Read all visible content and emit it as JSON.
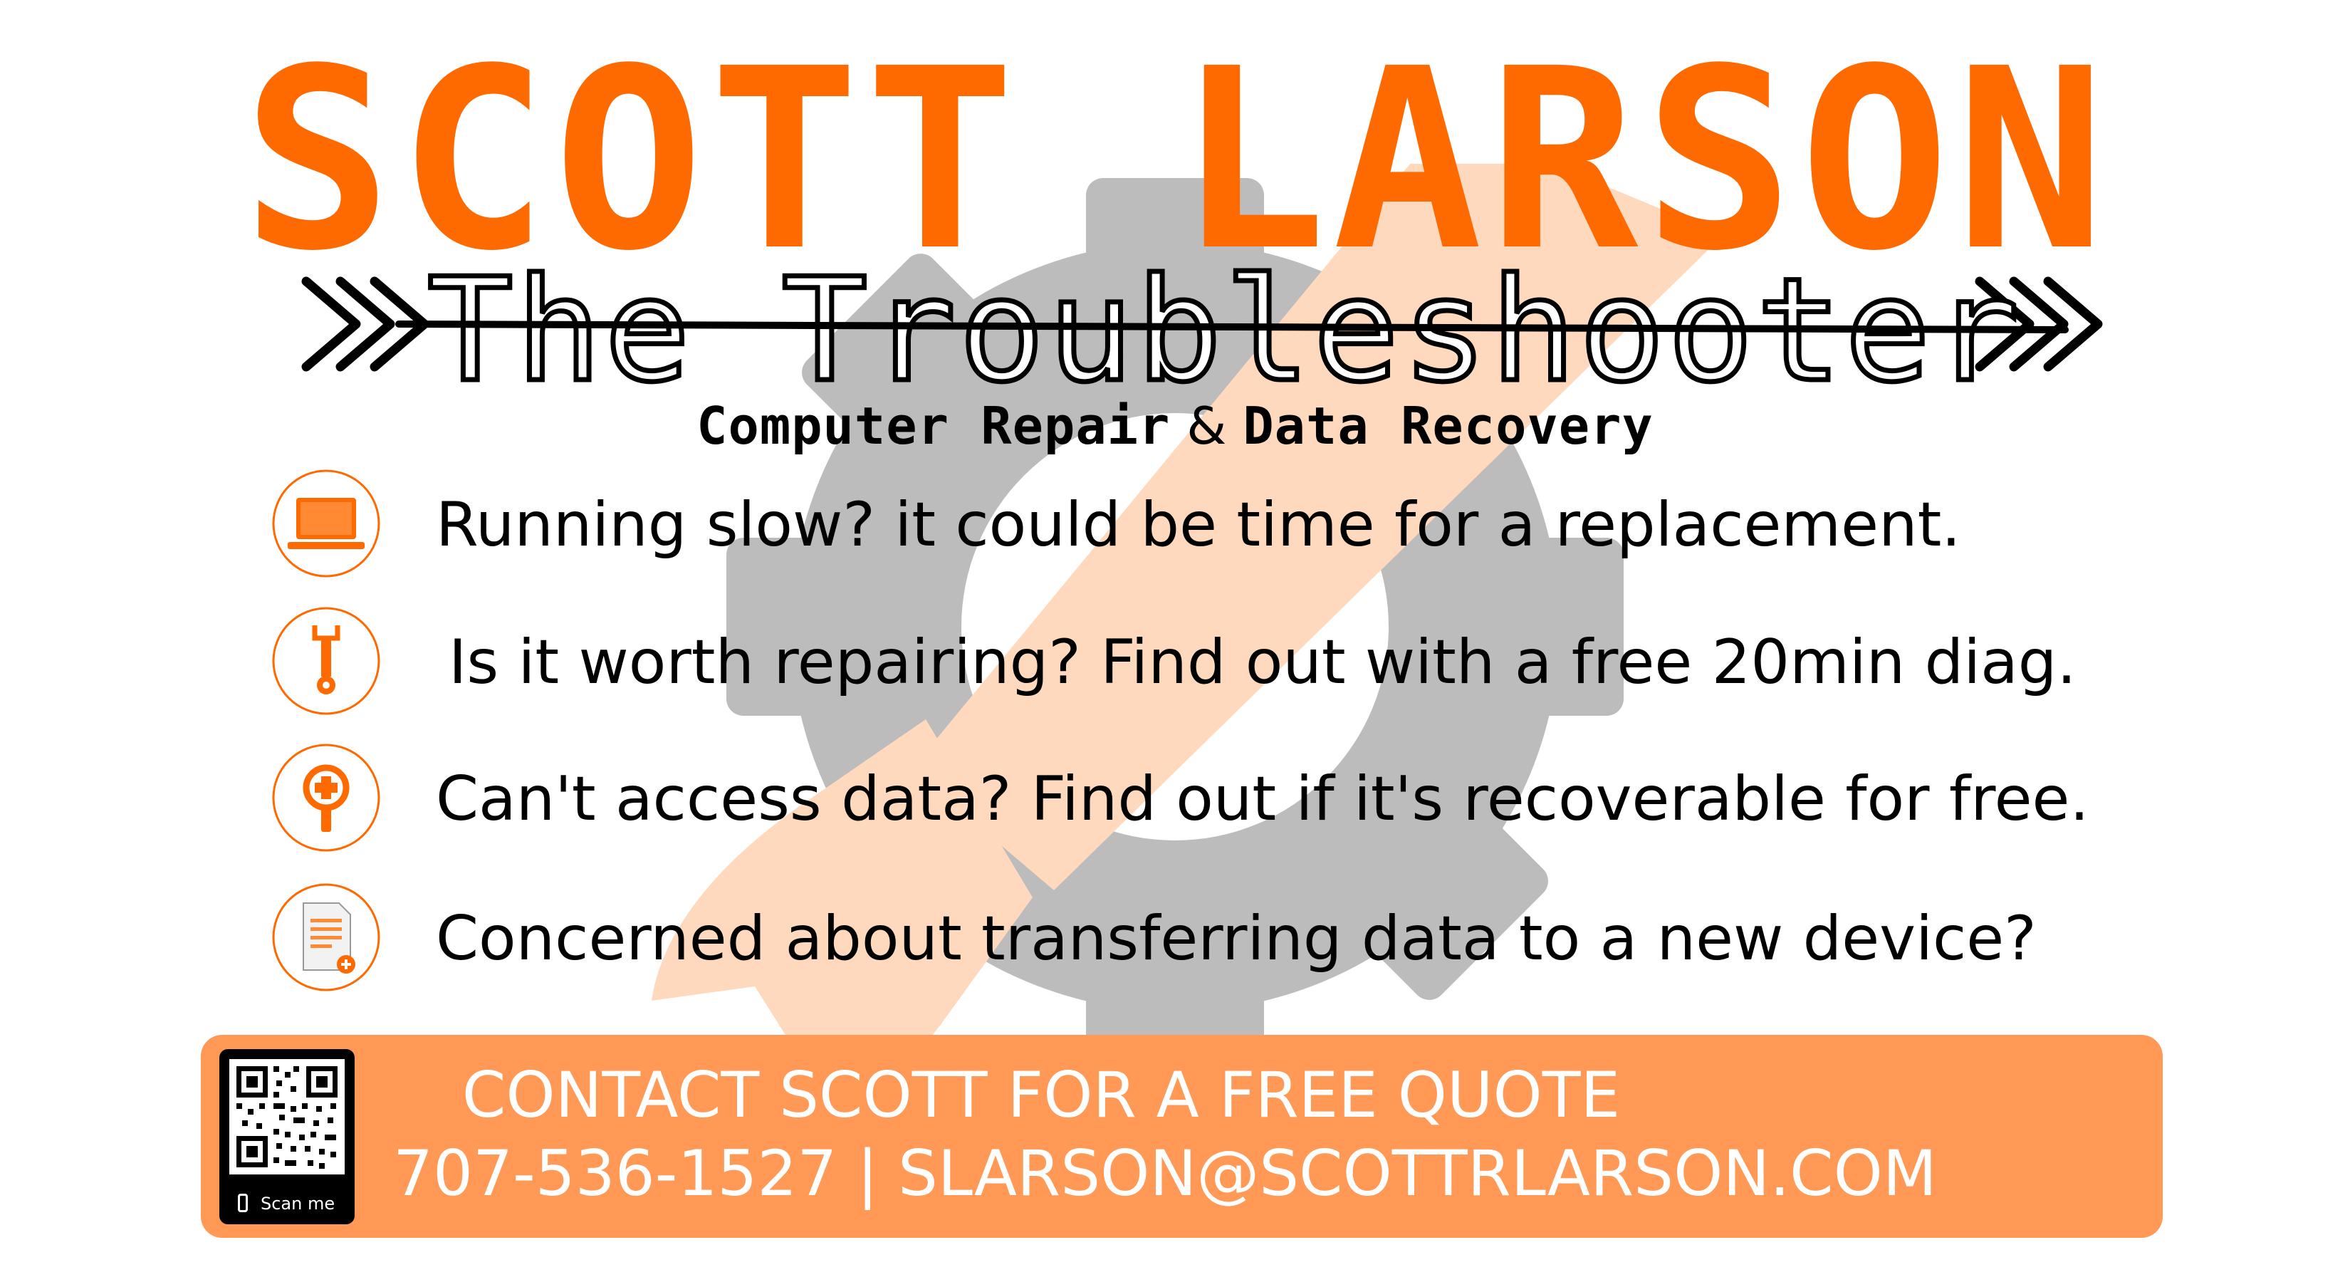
{
  "brand": {
    "name": "SCOTT LARSON",
    "tagline": "The Troubleshooter",
    "services_part1": "Computer Repair",
    "services_amp": "&",
    "services_part2": "Data Recovery"
  },
  "colors": {
    "brand_orange": "#ff6a00",
    "contact_bar": "#ff9955",
    "gear_gray": "#bcbcbc",
    "wrench_peach": "#ffd9bd"
  },
  "features": [
    {
      "icon": "laptop-icon",
      "text": "Running slow? it could be time for a replacement."
    },
    {
      "icon": "wrench-icon",
      "text": "Is it worth repairing? Find out with a free 20min diag."
    },
    {
      "icon": "data-recovery-icon",
      "text": "Can't access data? Find out if it's recoverable for free."
    },
    {
      "icon": "document-transfer-icon",
      "text": "Concerned about transferring data to a new device?"
    }
  ],
  "contact": {
    "cta": "CONTACT SCOTT FOR A FREE QUOTE",
    "details": "707-536-1527 | SLARSON@SCOTTRLARSON.COM",
    "qr_caption": "Scan me"
  }
}
